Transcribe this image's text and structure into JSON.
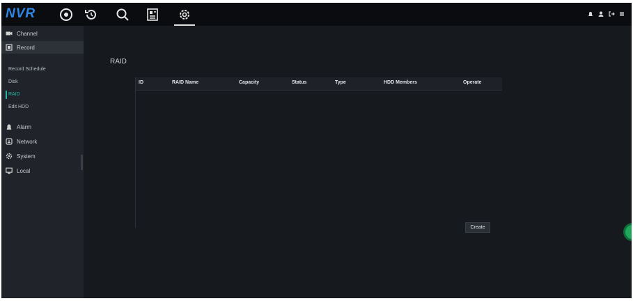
{
  "app": {
    "logo": "NVR"
  },
  "topbar": {
    "icons": [
      "live-view-icon",
      "playback-icon",
      "search-icon",
      "ai-analytics-icon",
      "settings-icon"
    ],
    "active": "settings-icon",
    "right_icons": [
      "alarm-icon",
      "user-icon",
      "logout-icon",
      "menu-icon"
    ]
  },
  "sidebar": {
    "items": [
      {
        "label": "Channel",
        "icon": "camera-icon"
      },
      {
        "label": "Record",
        "icon": "record-icon"
      },
      {
        "label": "Alarm",
        "icon": "alarm-icon"
      },
      {
        "label": "Network",
        "icon": "network-icon"
      },
      {
        "label": "System",
        "icon": "system-gear-icon"
      },
      {
        "label": "Local",
        "icon": "monitor-icon"
      }
    ],
    "record_subitems": [
      "Record Schedule",
      "Disk",
      "RAID",
      "Edit HDD"
    ]
  },
  "main": {
    "title": "RAID",
    "table": {
      "columns": [
        "ID",
        "RAID Name",
        "Capacity",
        "Status",
        "Type",
        "HDD Members",
        "Operate"
      ],
      "rows": []
    },
    "create_label": "Create"
  },
  "colors": {
    "accent": "#24b8a8",
    "logo": "#2f87e6",
    "assist_button": "#1fa65a"
  }
}
